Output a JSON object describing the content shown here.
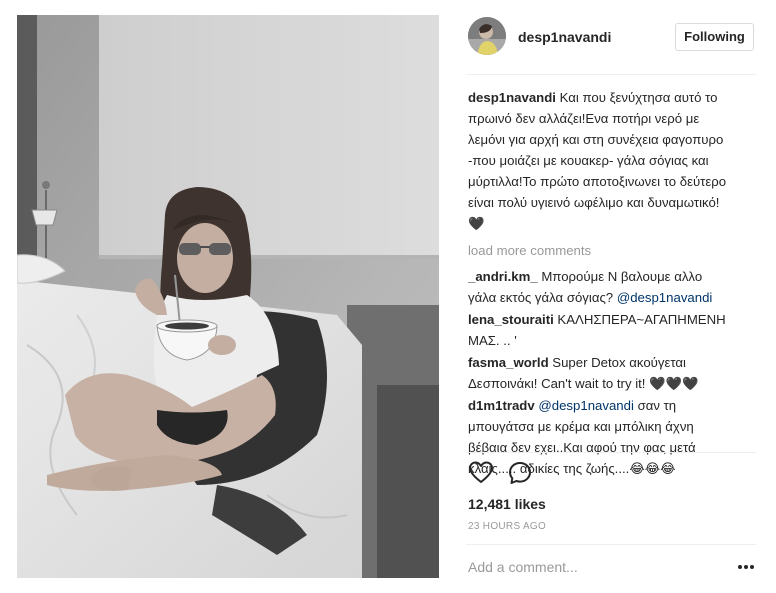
{
  "post": {
    "username": "desp1navandi",
    "follow_label": "Following",
    "caption": {
      "user": "desp1navandi",
      "text": "Και που ξενύχτησα αυτό το πρωινό δεν αλλάζει!Ενα ποτήρι νερό με λεμόνι για αρχή και στη συνέχεια φαγοπυρο -που μοιάζει με κουακερ- γάλα σόγιας και μύρτιλλα!Το πρώτο αποτοξινωνει το δεύτερο είναι πολύ υγιεινό ωφέλιμο και δυναμωτικό!🖤"
    },
    "load_more_label": "load more comments",
    "comments": [
      {
        "user": "_andri.km_",
        "text": "Μπορούμε Ν βαλουμε αλλο γάλα εκτός γάλα σόγιας?",
        "mention": "@desp1navandi",
        "trail": ""
      },
      {
        "user": "lena_stouraiti",
        "text": "ΚΑΛΗΣΠΕΡΑ~ΑΓΑΠΗΜΕΝΗ ΜΑΣ. .. '",
        "mention": "",
        "trail": ""
      },
      {
        "user": "fasma_world",
        "text": "Super Detox ακούγεται Δεσποινάκι! Can't wait to try it! 🖤🖤🖤",
        "mention": "",
        "trail": ""
      },
      {
        "user": "d1m1tradv",
        "text": "",
        "mention": "@desp1navandi",
        "trail": "σαν τη μπουγάτσα με κρέμα και μπόλικη άχνη βέβαια δεν εχει..Και αφού την φας μετά κλαίς..... αδικίες της ζωής....😂😂😂"
      }
    ],
    "likes": "12,481 likes",
    "time": "23 HOURS AGO",
    "add_comment_placeholder": "Add a comment...",
    "more_label": "•••"
  },
  "icons": {
    "like": "heart-outline-icon",
    "comment": "speech-bubble-icon",
    "more": "more-dots-icon"
  },
  "colors": {
    "text": "#262626",
    "muted": "#999999",
    "mention": "#003569",
    "border": "#dbdbdb"
  }
}
